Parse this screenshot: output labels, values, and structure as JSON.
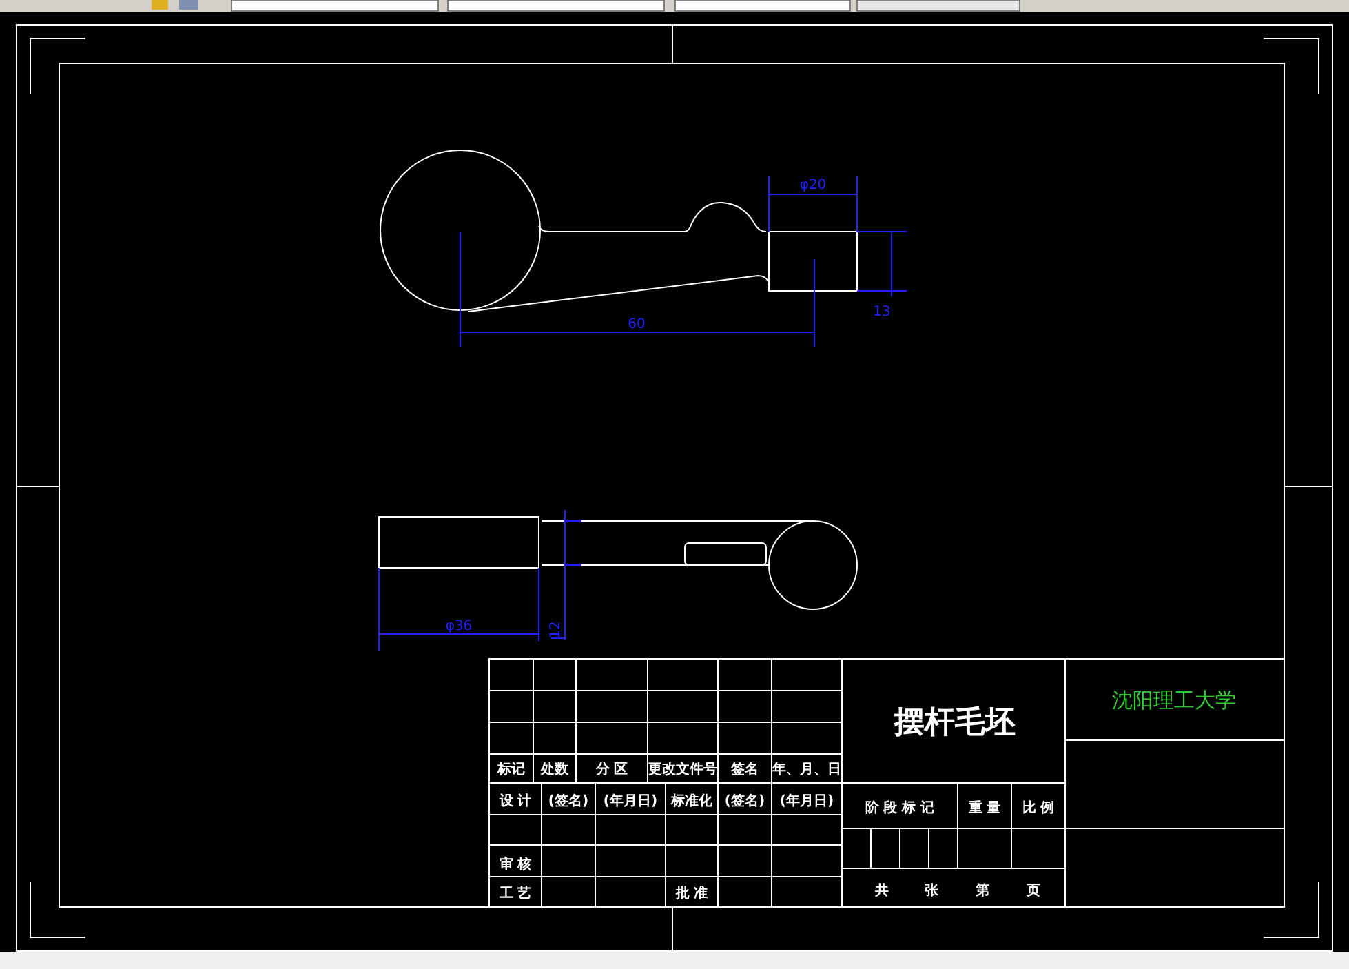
{
  "drawing": {
    "top_view_dimensions": [
      {
        "kind": "diameter",
        "text": "φ20"
      },
      {
        "kind": "height",
        "text": "13"
      },
      {
        "kind": "length",
        "text": "60"
      }
    ],
    "front_view_dimensions": [
      {
        "kind": "diameter",
        "text": "φ36"
      },
      {
        "kind": "height",
        "text": "12"
      }
    ]
  },
  "title_block": {
    "revision_headers": [
      "标记",
      "处数",
      "分 区",
      "更改文件号",
      "签名",
      "年、月、日"
    ],
    "sign_row": [
      "设 计",
      "(签名)",
      "(年月日)",
      "标准化",
      "(签名)",
      "(年月日)"
    ],
    "review_label": "审 核",
    "process_label": "工 艺",
    "approve_label": "批 准",
    "part_name": "摆杆毛坯",
    "school": "沈阳理工大学",
    "stage_headers": [
      "阶 段 标 记",
      "重 量",
      "比 例"
    ],
    "sheet_info": [
      "共",
      "张",
      "第",
      "页"
    ]
  }
}
